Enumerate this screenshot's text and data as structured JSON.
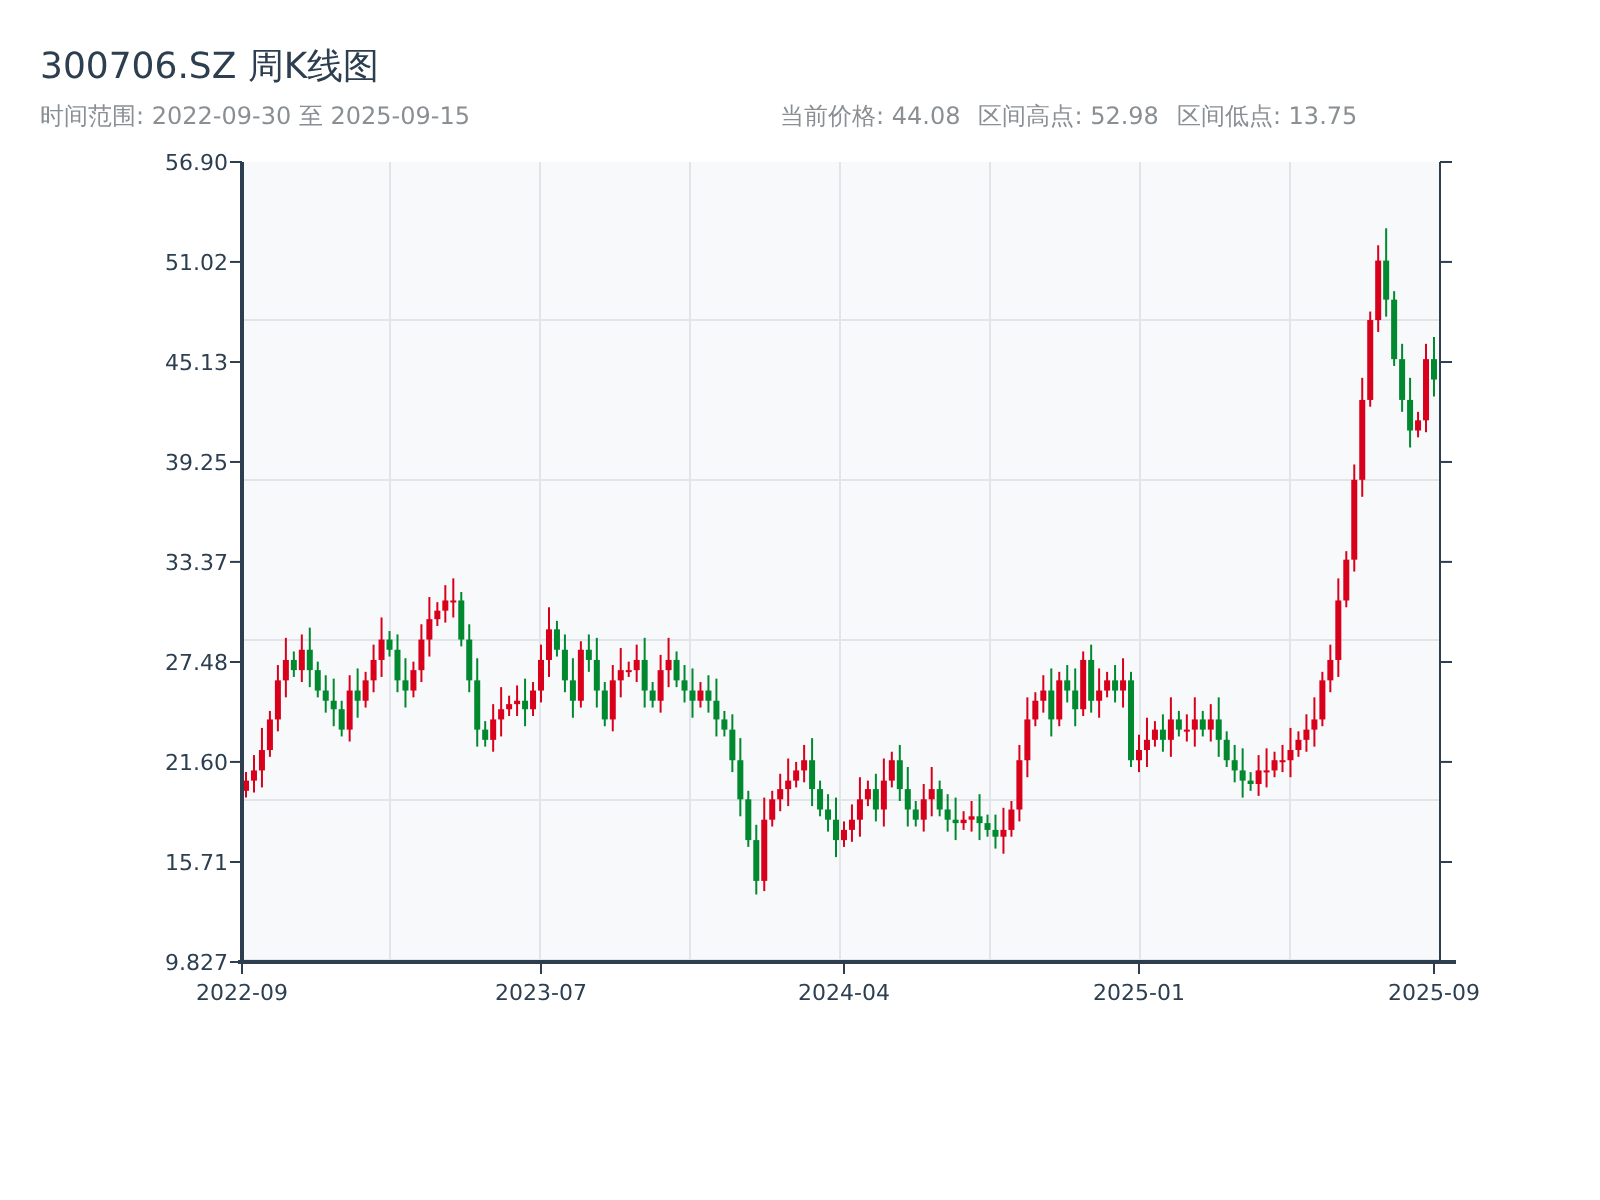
{
  "header": {
    "title": "300706.SZ 周K线图",
    "time_range": "时间范围: 2022-09-30 至 2025-09-15",
    "stats": [
      "当前价格: 44.08",
      "区间高点: 52.98",
      "区间低点: 13.75"
    ]
  },
  "chart": {
    "chart_data": {
      "type": "candlestick",
      "ylim": [
        9.827,
        56.9
      ],
      "yticks": [
        {
          "value": 56.9,
          "label": "56.90"
        },
        {
          "value": 51.02,
          "label": "51.02"
        },
        {
          "value": 45.13,
          "label": "45.13"
        },
        {
          "value": 39.25,
          "label": "39.25"
        },
        {
          "value": 33.37,
          "label": "33.37"
        },
        {
          "value": 27.48,
          "label": "27.48"
        },
        {
          "value": 21.6,
          "label": "21.60"
        },
        {
          "value": 15.71,
          "label": "15.71"
        },
        {
          "value": 9.827,
          "label": "9.827"
        }
      ],
      "categories": [
        "2022-09",
        null,
        null,
        null,
        null,
        null,
        null,
        null,
        null,
        null,
        null,
        null,
        null,
        null,
        null,
        null,
        null,
        null,
        null,
        null,
        null,
        null,
        null,
        null,
        null,
        null,
        null,
        null,
        null,
        null,
        null,
        null,
        null,
        null,
        null,
        null,
        null,
        "2023-07",
        null,
        null,
        null,
        null,
        null,
        null,
        null,
        null,
        null,
        null,
        null,
        null,
        null,
        null,
        null,
        null,
        null,
        null,
        null,
        null,
        null,
        null,
        null,
        null,
        null,
        null,
        null,
        null,
        null,
        null,
        null,
        null,
        null,
        null,
        null,
        null,
        null,
        "2024-04",
        null,
        null,
        null,
        null,
        null,
        null,
        null,
        null,
        null,
        null,
        null,
        null,
        null,
        null,
        null,
        null,
        null,
        null,
        null,
        null,
        null,
        null,
        null,
        null,
        null,
        null,
        null,
        null,
        null,
        null,
        null,
        null,
        null,
        null,
        null,
        null,
        "2025-01",
        null,
        null,
        null,
        null,
        null,
        null,
        null,
        null,
        null,
        null,
        null,
        null,
        null,
        null,
        null,
        null,
        null,
        null,
        null,
        null,
        null,
        null,
        null,
        null,
        null,
        null,
        null,
        null,
        null,
        null,
        null,
        null,
        null,
        null,
        null,
        null,
        "2025-09"
      ],
      "ohlc": [
        [
          19.9,
          21.0,
          19.5,
          20.5
        ],
        [
          20.5,
          22.0,
          19.8,
          21.1
        ],
        [
          21.1,
          23.6,
          20.1,
          22.3
        ],
        [
          22.3,
          24.6,
          21.9,
          24.1
        ],
        [
          24.1,
          27.3,
          23.4,
          26.4
        ],
        [
          26.4,
          28.9,
          25.4,
          27.6
        ],
        [
          27.6,
          28.1,
          26.6,
          27.0
        ],
        [
          27.0,
          29.1,
          26.3,
          28.2
        ],
        [
          28.2,
          29.5,
          26.0,
          27.0
        ],
        [
          27.0,
          27.5,
          25.4,
          25.8
        ],
        [
          25.8,
          26.7,
          24.5,
          25.2
        ],
        [
          25.2,
          26.5,
          23.7,
          24.7
        ],
        [
          24.7,
          25.2,
          23.1,
          23.5
        ],
        [
          23.5,
          26.7,
          22.8,
          25.8
        ],
        [
          25.8,
          27.1,
          24.2,
          25.2
        ],
        [
          25.2,
          26.9,
          24.8,
          26.4
        ],
        [
          26.4,
          28.5,
          25.7,
          27.6
        ],
        [
          27.6,
          30.1,
          26.6,
          28.8
        ],
        [
          28.8,
          29.3,
          27.8,
          28.2
        ],
        [
          28.2,
          29.1,
          25.7,
          26.4
        ],
        [
          26.4,
          27.7,
          24.8,
          25.8
        ],
        [
          25.8,
          27.5,
          25.4,
          27.0
        ],
        [
          27.0,
          29.7,
          26.3,
          28.8
        ],
        [
          28.8,
          31.3,
          27.8,
          30.0
        ],
        [
          30.0,
          31.0,
          29.6,
          30.5
        ],
        [
          30.5,
          32.0,
          29.8,
          31.1
        ],
        [
          31.1,
          32.4,
          30.1,
          31.1
        ],
        [
          31.1,
          31.6,
          28.4,
          28.8
        ],
        [
          28.8,
          29.7,
          25.7,
          26.4
        ],
        [
          26.4,
          27.7,
          22.5,
          23.5
        ],
        [
          23.5,
          24.0,
          22.5,
          22.9
        ],
        [
          22.9,
          25.0,
          22.2,
          24.1
        ],
        [
          24.1,
          26.0,
          23.1,
          24.7
        ],
        [
          24.7,
          25.5,
          24.3,
          25.0
        ],
        [
          25.0,
          26.1,
          24.3,
          25.2
        ],
        [
          25.2,
          26.5,
          23.7,
          24.7
        ],
        [
          24.7,
          26.3,
          24.3,
          25.8
        ],
        [
          25.8,
          28.5,
          25.1,
          27.6
        ],
        [
          27.6,
          30.7,
          26.6,
          29.4
        ],
        [
          29.4,
          29.9,
          27.8,
          28.2
        ],
        [
          28.2,
          29.1,
          25.7,
          26.4
        ],
        [
          26.4,
          27.7,
          24.2,
          25.2
        ],
        [
          25.2,
          28.7,
          24.8,
          28.2
        ],
        [
          28.2,
          29.1,
          26.9,
          27.6
        ],
        [
          27.6,
          28.9,
          24.8,
          25.8
        ],
        [
          25.8,
          26.3,
          23.7,
          24.1
        ],
        [
          24.1,
          27.3,
          23.4,
          26.4
        ],
        [
          26.4,
          28.3,
          25.4,
          27.0
        ],
        [
          27.0,
          27.5,
          26.6,
          27.0
        ],
        [
          27.0,
          28.5,
          26.3,
          27.6
        ],
        [
          27.6,
          28.9,
          24.8,
          25.8
        ],
        [
          25.8,
          26.3,
          24.8,
          25.2
        ],
        [
          25.2,
          27.9,
          24.5,
          27.0
        ],
        [
          27.0,
          28.9,
          26.0,
          27.6
        ],
        [
          27.6,
          28.1,
          26.0,
          26.4
        ],
        [
          26.4,
          27.3,
          25.1,
          25.8
        ],
        [
          25.8,
          27.1,
          24.2,
          25.2
        ],
        [
          25.2,
          26.3,
          24.8,
          25.8
        ],
        [
          25.8,
          26.7,
          24.5,
          25.2
        ],
        [
          25.2,
          26.5,
          23.1,
          24.1
        ],
        [
          24.1,
          24.6,
          23.1,
          23.5
        ],
        [
          23.5,
          24.4,
          21.0,
          21.7
        ],
        [
          21.7,
          23.0,
          18.4,
          19.4
        ],
        [
          19.4,
          19.9,
          16.6,
          17.0
        ],
        [
          17.0,
          17.9,
          13.8,
          14.6
        ],
        [
          14.6,
          19.5,
          14.0,
          18.2
        ],
        [
          18.2,
          19.9,
          17.8,
          19.4
        ],
        [
          19.4,
          20.9,
          18.7,
          20.0
        ],
        [
          20.0,
          21.8,
          19.0,
          20.5
        ],
        [
          20.5,
          21.6,
          20.1,
          21.1
        ],
        [
          21.1,
          22.6,
          20.4,
          21.7
        ],
        [
          21.7,
          23.0,
          19.0,
          20.0
        ],
        [
          20.0,
          20.5,
          18.4,
          18.8
        ],
        [
          18.8,
          19.7,
          17.5,
          18.2
        ],
        [
          18.2,
          19.5,
          16.0,
          17.0
        ],
        [
          17.0,
          18.1,
          16.6,
          17.6
        ],
        [
          17.6,
          19.1,
          16.9,
          18.2
        ],
        [
          18.2,
          20.7,
          17.2,
          19.4
        ],
        [
          19.4,
          20.5,
          19.0,
          20.0
        ],
        [
          20.0,
          20.9,
          18.1,
          18.8
        ],
        [
          18.8,
          21.8,
          17.8,
          20.5
        ],
        [
          20.5,
          22.2,
          20.1,
          21.7
        ],
        [
          21.7,
          22.6,
          19.3,
          20.0
        ],
        [
          20.0,
          21.3,
          17.8,
          18.8
        ],
        [
          18.8,
          19.3,
          17.8,
          18.2
        ],
        [
          18.2,
          20.3,
          17.5,
          19.4
        ],
        [
          19.4,
          21.3,
          18.4,
          20.0
        ],
        [
          20.0,
          20.5,
          18.4,
          18.8
        ],
        [
          18.8,
          19.7,
          17.5,
          18.2
        ],
        [
          18.2,
          19.5,
          17.0,
          18.0
        ],
        [
          18.0,
          18.7,
          17.6,
          18.2
        ],
        [
          18.2,
          19.3,
          17.5,
          18.4
        ],
        [
          18.4,
          19.7,
          17.0,
          18.0
        ],
        [
          18.0,
          18.5,
          17.2,
          17.6
        ],
        [
          17.6,
          18.5,
          16.5,
          17.2
        ],
        [
          17.2,
          18.9,
          16.2,
          17.6
        ],
        [
          17.6,
          19.3,
          17.2,
          18.8
        ],
        [
          18.8,
          22.6,
          18.1,
          21.7
        ],
        [
          21.7,
          25.4,
          20.7,
          24.1
        ],
        [
          24.1,
          25.7,
          23.7,
          25.2
        ],
        [
          25.2,
          26.7,
          24.5,
          25.8
        ],
        [
          25.8,
          27.1,
          23.1,
          24.1
        ],
        [
          24.1,
          26.9,
          23.7,
          26.4
        ],
        [
          26.4,
          27.3,
          25.1,
          25.8
        ],
        [
          25.8,
          27.1,
          23.7,
          24.7
        ],
        [
          24.7,
          28.1,
          24.3,
          27.6
        ],
        [
          27.6,
          28.5,
          24.5,
          25.2
        ],
        [
          25.2,
          27.1,
          24.2,
          25.8
        ],
        [
          25.8,
          26.9,
          25.4,
          26.4
        ],
        [
          26.4,
          27.3,
          25.1,
          25.8
        ],
        [
          25.8,
          27.7,
          24.8,
          26.4
        ],
        [
          26.4,
          26.9,
          21.3,
          21.7
        ],
        [
          21.7,
          23.2,
          21.0,
          22.3
        ],
        [
          22.3,
          24.2,
          21.3,
          22.9
        ],
        [
          22.9,
          24.0,
          22.5,
          23.5
        ],
        [
          23.5,
          24.4,
          22.2,
          22.9
        ],
        [
          22.9,
          25.4,
          21.9,
          24.1
        ],
        [
          24.1,
          24.6,
          23.1,
          23.5
        ],
        [
          23.5,
          24.4,
          22.8,
          23.5
        ],
        [
          23.5,
          25.4,
          22.5,
          24.1
        ],
        [
          24.1,
          24.6,
          23.1,
          23.5
        ],
        [
          23.5,
          25.0,
          22.8,
          24.1
        ],
        [
          24.1,
          25.4,
          21.9,
          22.9
        ],
        [
          22.9,
          23.4,
          21.3,
          21.7
        ],
        [
          21.7,
          22.6,
          20.4,
          21.1
        ],
        [
          21.1,
          22.4,
          19.5,
          20.5
        ],
        [
          20.5,
          21.0,
          19.9,
          20.3
        ],
        [
          20.3,
          22.0,
          19.6,
          21.1
        ],
        [
          21.1,
          22.4,
          20.1,
          21.1
        ],
        [
          21.1,
          22.2,
          20.7,
          21.7
        ],
        [
          21.7,
          22.6,
          21.0,
          21.7
        ],
        [
          21.7,
          23.6,
          20.7,
          22.3
        ],
        [
          22.3,
          23.4,
          21.9,
          22.9
        ],
        [
          22.9,
          24.4,
          22.2,
          23.5
        ],
        [
          23.5,
          25.4,
          22.5,
          24.1
        ],
        [
          24.1,
          26.9,
          23.7,
          26.4
        ],
        [
          26.4,
          28.5,
          25.7,
          27.6
        ],
        [
          27.6,
          32.4,
          26.6,
          31.1
        ],
        [
          31.1,
          34.0,
          30.7,
          33.5
        ],
        [
          33.5,
          39.1,
          32.8,
          38.2
        ],
        [
          38.2,
          44.2,
          37.2,
          42.9
        ],
        [
          42.9,
          48.1,
          42.5,
          47.6
        ],
        [
          47.6,
          52.0,
          46.9,
          51.1
        ],
        [
          51.1,
          53.0,
          47.8,
          48.8
        ],
        [
          48.8,
          49.3,
          44.9,
          45.3
        ],
        [
          45.3,
          46.2,
          42.2,
          42.9
        ],
        [
          42.9,
          44.2,
          40.1,
          41.1
        ],
        [
          41.1,
          42.2,
          40.7,
          41.7
        ],
        [
          41.7,
          46.2,
          41.0,
          45.3
        ],
        [
          45.3,
          46.6,
          43.1,
          44.1
        ]
      ]
    }
  }
}
